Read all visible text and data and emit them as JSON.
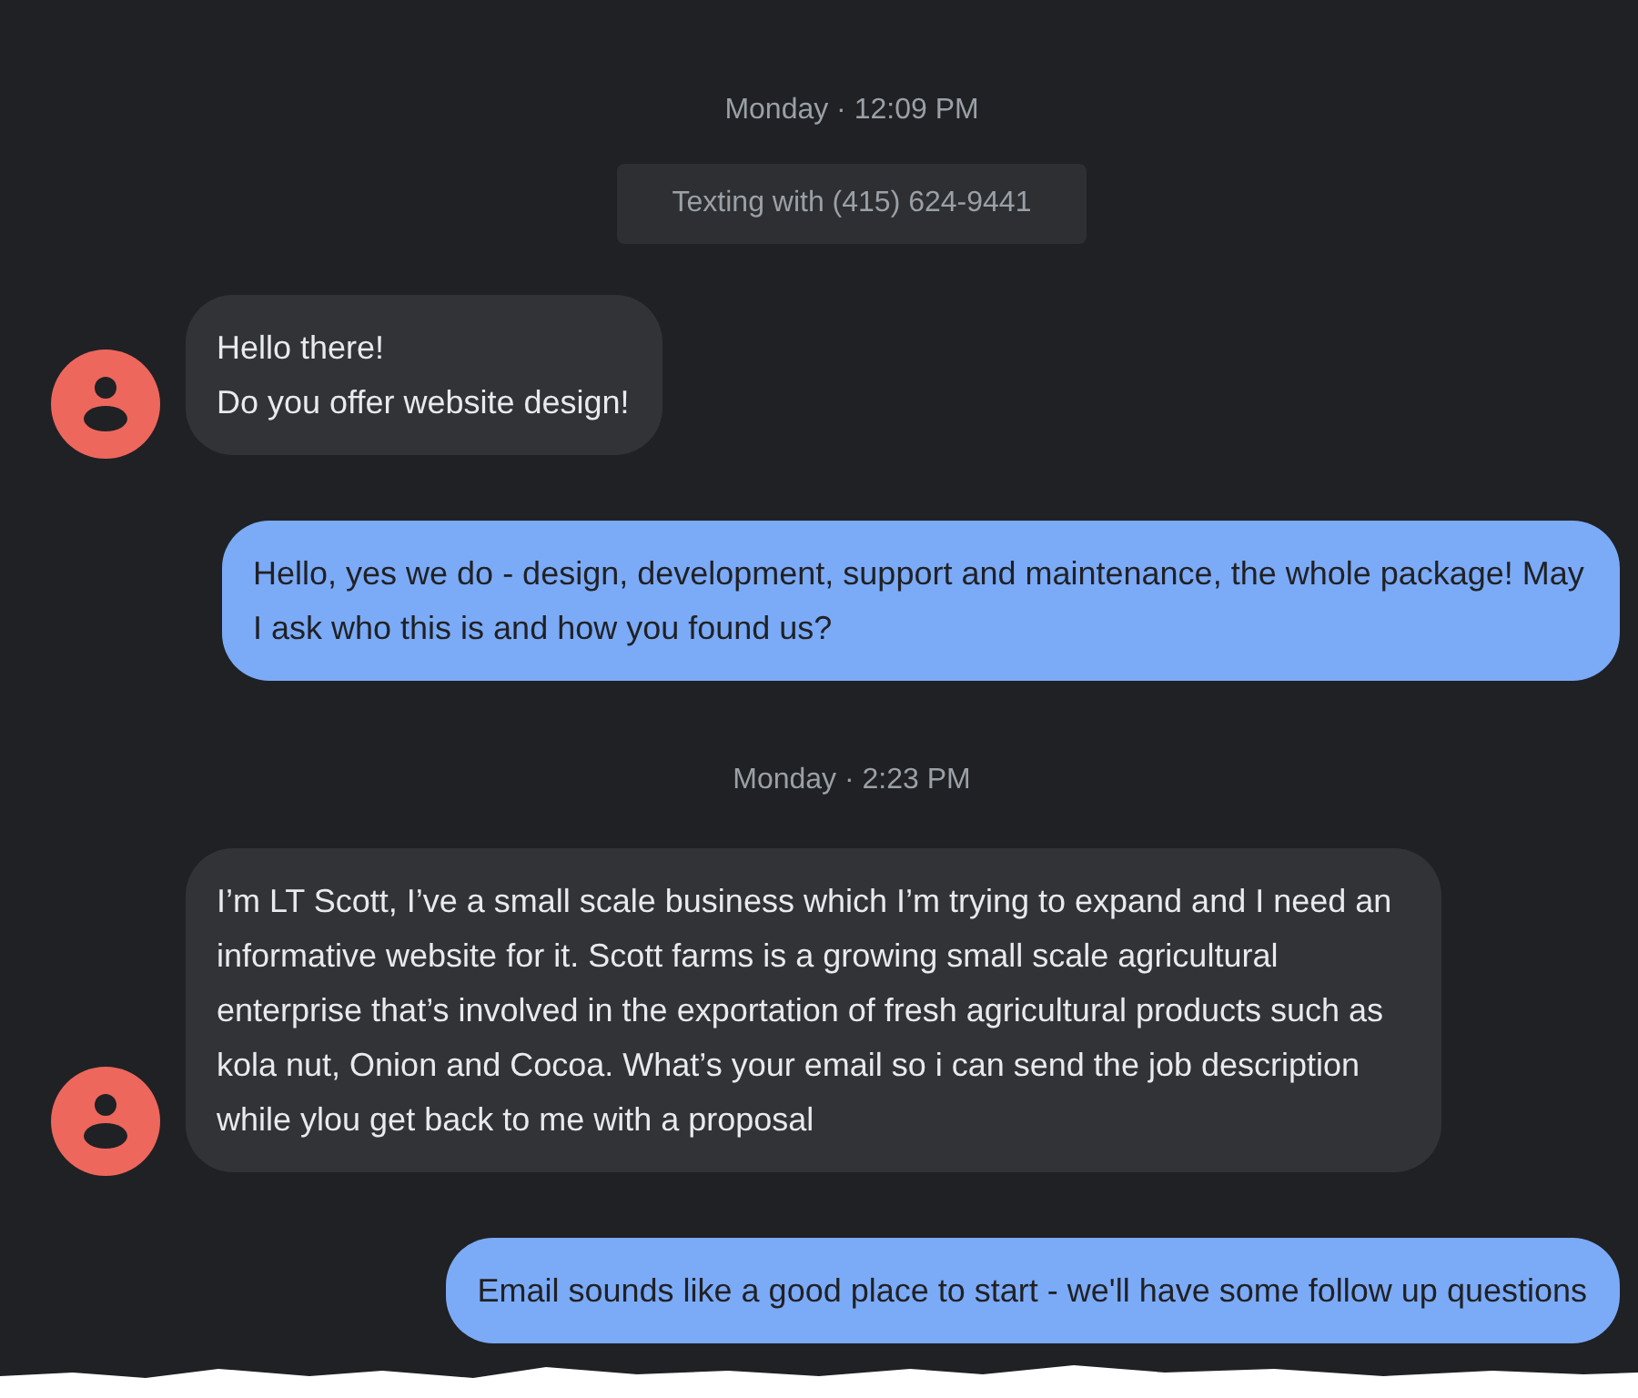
{
  "thread": [
    {
      "kind": "timestamp",
      "text": "Monday · 12:09 PM"
    },
    {
      "kind": "info",
      "text": "Texting with (415) 624-9441"
    },
    {
      "kind": "incoming",
      "lines": [
        "Hello there!",
        "Do you offer website design!"
      ]
    },
    {
      "kind": "outgoing",
      "lines": [
        "Hello, yes we do - design, development, support and maintenance, the whole package!  May I ask who this is and how you found us?"
      ]
    },
    {
      "kind": "timestamp",
      "text": "Monday · 2:23 PM"
    },
    {
      "kind": "incoming",
      "lines": [
        "I’m LT Scott, I’ve a small scale business which I’m trying to expand and I need an informative website for it. Scott farms is a growing small scale agricultural enterprise that’s involved in the exportation of fresh agricultural products such as kola nut, Onion and Cocoa. What’s your email so i can send the job description while ylou get back to me with a proposal"
      ]
    },
    {
      "kind": "outgoing",
      "lines": [
        "Email sounds like a good place to start - we'll have some follow up questions"
      ]
    }
  ]
}
